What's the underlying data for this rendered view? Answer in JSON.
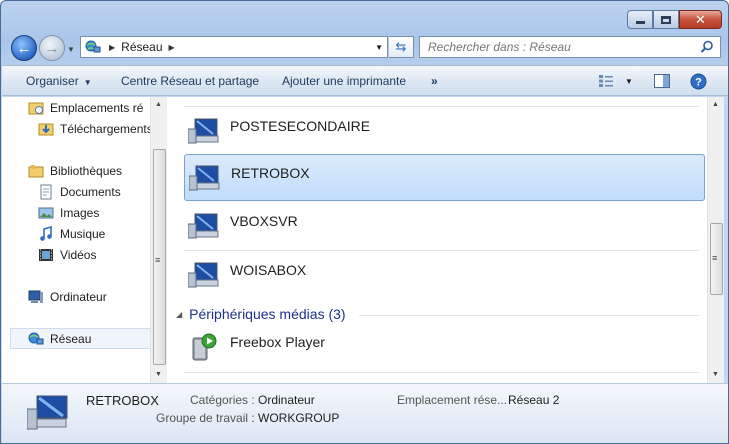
{
  "address": {
    "crumbs": [
      "Réseau"
    ]
  },
  "search": {
    "placeholder": "Rechercher dans : Réseau"
  },
  "toolbar": {
    "organiser": "Organiser",
    "network_center": "Centre Réseau et partage",
    "add_printer": "Ajouter une imprimante",
    "more": "»"
  },
  "sidebar": {
    "items": [
      {
        "label": "Emplacements ré",
        "icon": "recent-places-icon"
      },
      {
        "label": "Téléchargements",
        "icon": "downloads-folder-icon"
      },
      {
        "label": "Bibliothèques",
        "icon": "libraries-icon"
      },
      {
        "label": "Documents",
        "icon": "documents-icon"
      },
      {
        "label": "Images",
        "icon": "images-icon"
      },
      {
        "label": "Musique",
        "icon": "music-icon"
      },
      {
        "label": "Vidéos",
        "icon": "videos-icon"
      },
      {
        "label": "Ordinateur",
        "icon": "computer-icon"
      },
      {
        "label": "Réseau",
        "icon": "network-icon",
        "selected": true
      }
    ]
  },
  "content": {
    "computers": [
      {
        "name": "POSTESECONDAIRE"
      },
      {
        "name": "RETROBOX",
        "selected": true
      },
      {
        "name": "VBOXSVR"
      },
      {
        "name": "WOISABOX"
      }
    ],
    "media_group": {
      "title": "Périphériques médias (3)"
    },
    "media_devices": [
      {
        "name": "Freebox Player"
      }
    ]
  },
  "details": {
    "name": "RETROBOX",
    "categories_label": "Catégories :",
    "categories_value": "Ordinateur",
    "workgroup_label": "Groupe de travail :",
    "workgroup_value": "WORKGROUP",
    "location_label": "Emplacement rése...",
    "location_value": "Réseau  2"
  }
}
